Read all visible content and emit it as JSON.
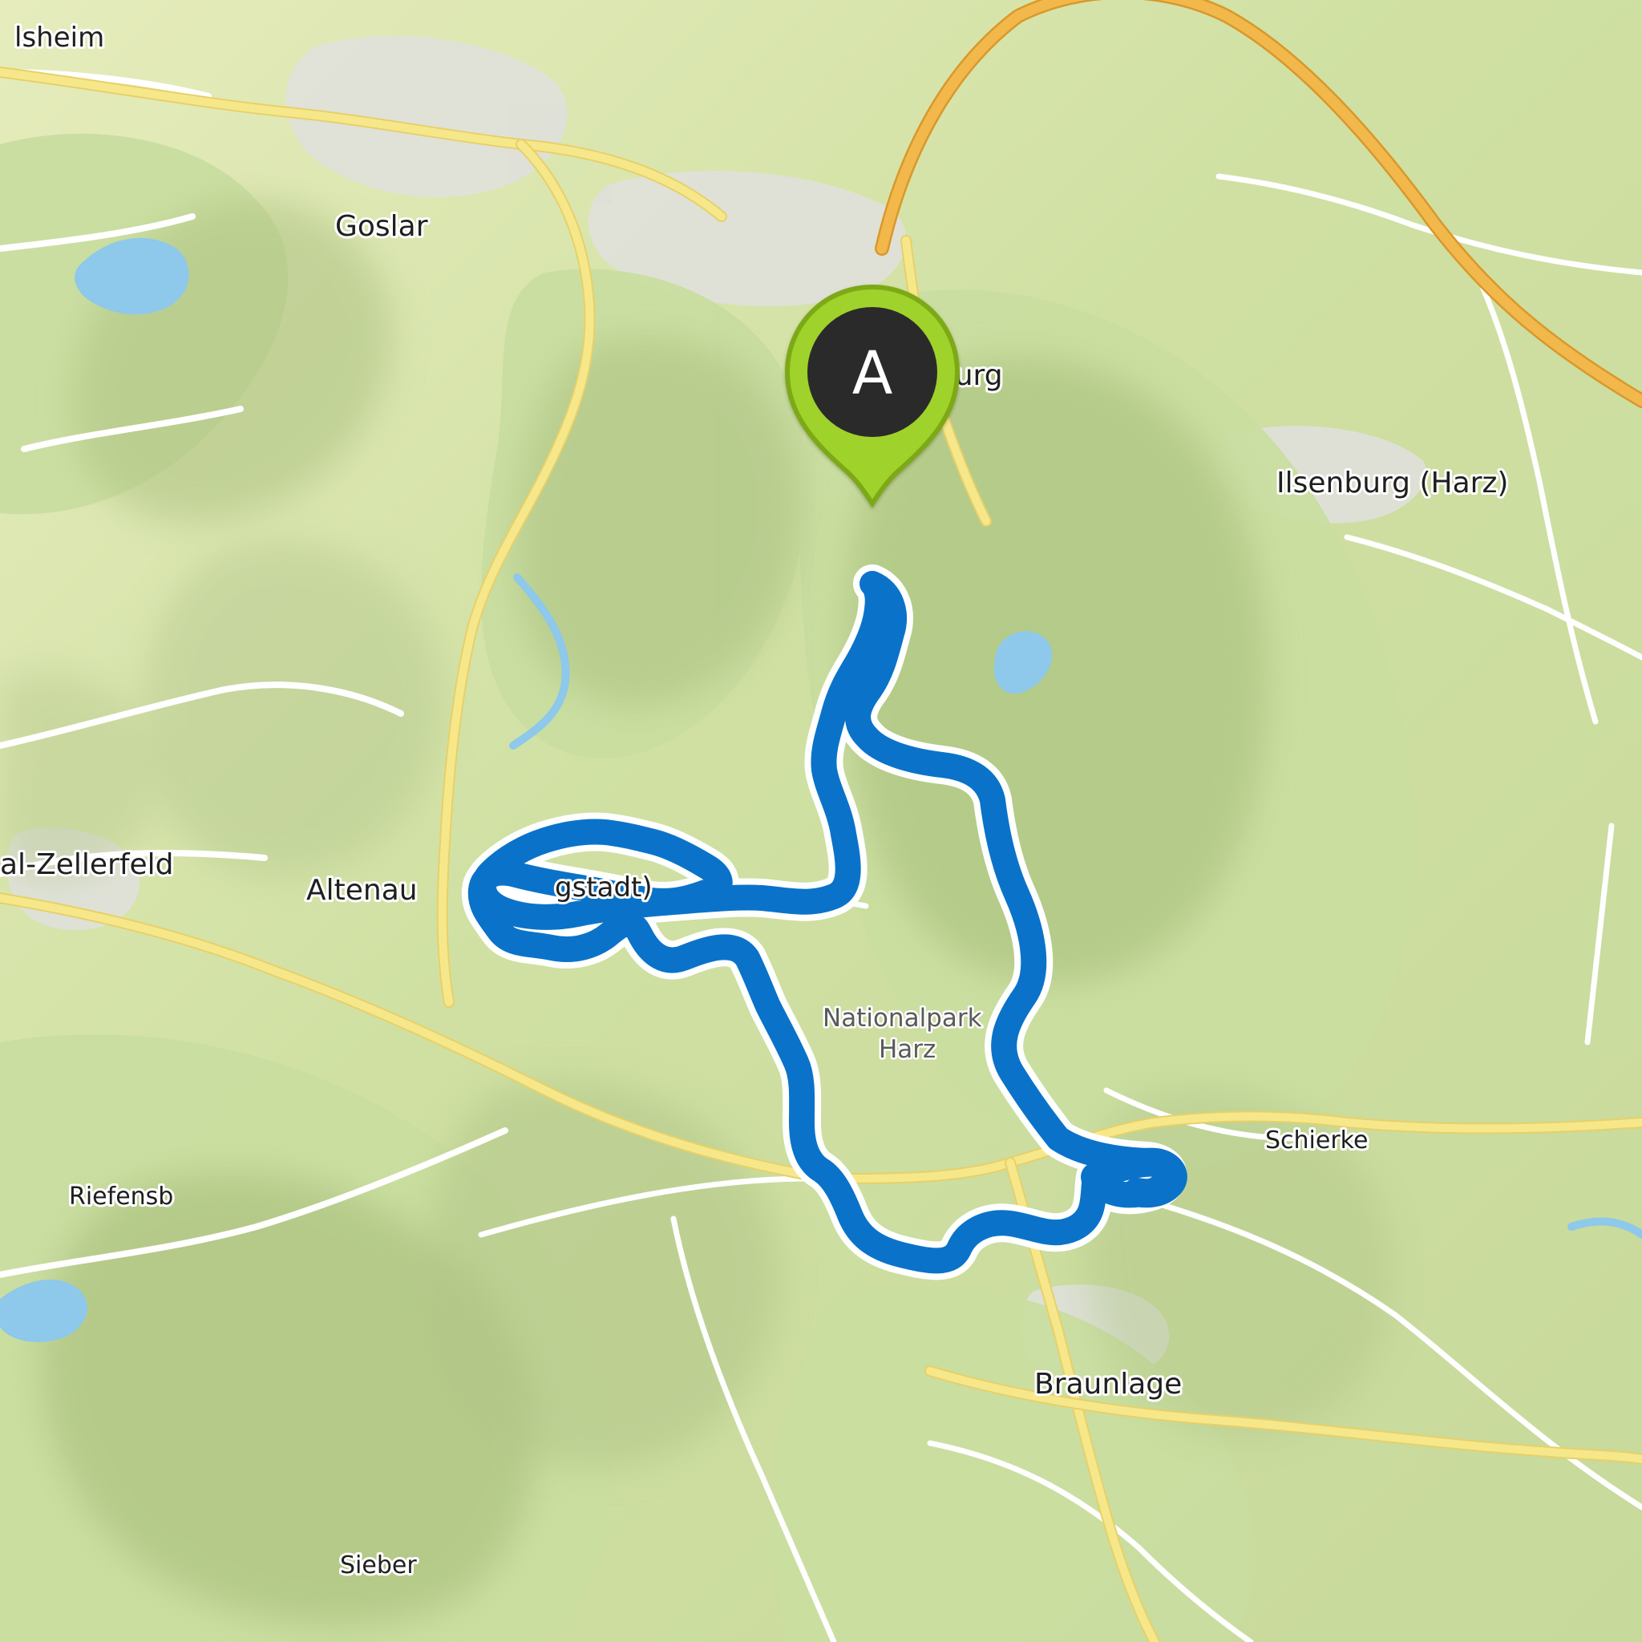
{
  "map": {
    "region": "Harz",
    "places": [
      {
        "id": "place-hildesheim-partial",
        "label": "lsheim"
      },
      {
        "id": "place-goslar",
        "label": "Goslar"
      },
      {
        "id": "place-bad-harzburg",
        "label": "Bad Harzburg"
      },
      {
        "id": "place-ilsenburg",
        "label": "Ilsenburg (Harz)"
      },
      {
        "id": "place-clausthal-zellerfeld-partial",
        "label": "al-Zellerfeld"
      },
      {
        "id": "place-altenau",
        "label": "Altenau"
      },
      {
        "id": "place-altenau-suffix-partial",
        "label": "gstadt)"
      },
      {
        "id": "place-nationalpark-harz",
        "label": "Nationalpark\nHarz"
      },
      {
        "id": "place-schierke",
        "label": "Schierke"
      },
      {
        "id": "place-riefensbeek-partial",
        "label": "Riefensb"
      },
      {
        "id": "place-braunlage",
        "label": "Braunlage"
      },
      {
        "id": "place-sieber",
        "label": "Sieber"
      }
    ],
    "start_marker": {
      "label": "A",
      "icon": "map-pin-icon",
      "fill_color": "#9fd22c",
      "inner_color": "#2b2b2b"
    },
    "route": {
      "color": "#0a73c9",
      "outline_color": "#ffffff"
    }
  },
  "colors": {
    "terrain_base": "#d9e6b0",
    "forest": "#c9dda0",
    "hill_shade": "#b8c98f",
    "urban": "#e0e0de",
    "water": "#8ec8ea",
    "minor_road": "#ffffff",
    "main_road": "#f5e77f",
    "motorway": "#f0b33a"
  }
}
